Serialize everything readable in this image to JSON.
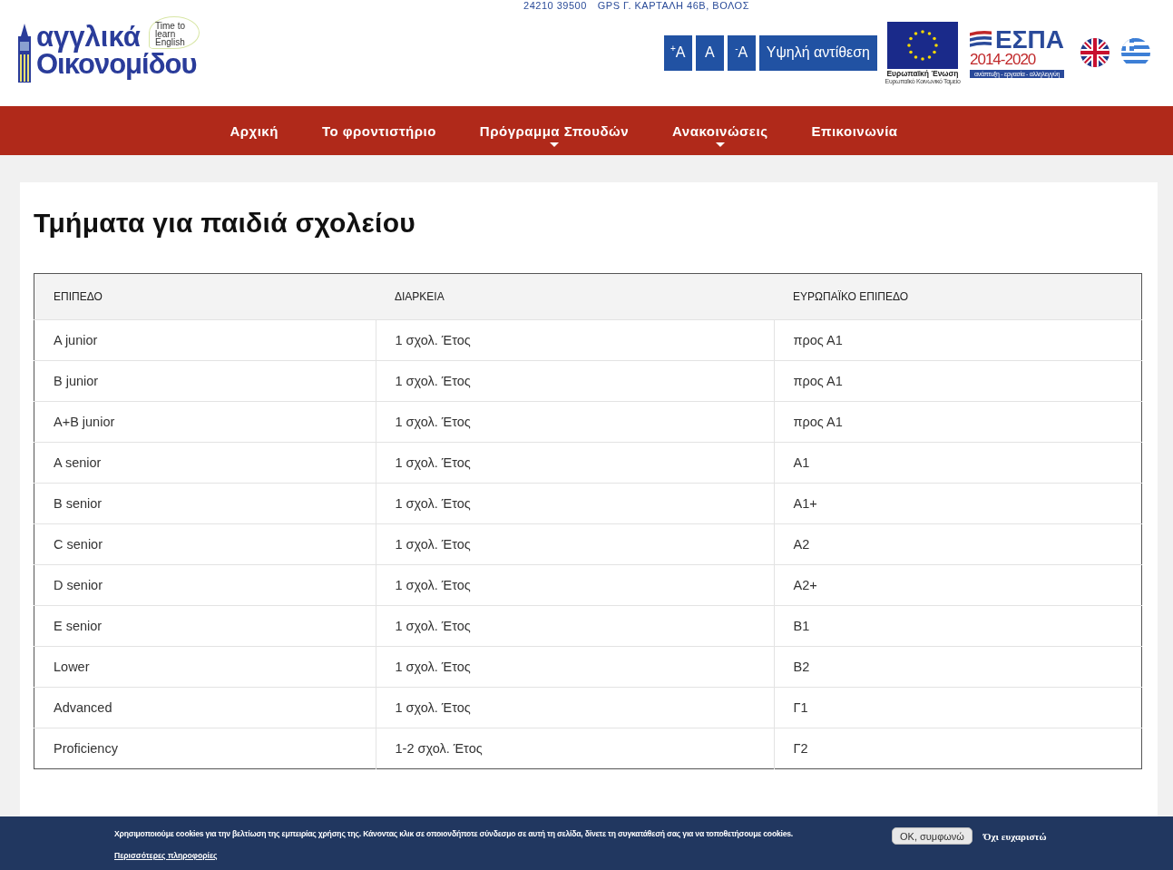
{
  "topbar": {
    "phone": "24210 39500",
    "address": "GPS Γ. ΚΑΡΤΑΛΗ 46Β, ΒΟΛΟΣ"
  },
  "logo": {
    "line_1": "αγγλικά",
    "line_2": "Οικονομίδου",
    "bubble": "Time to learn English"
  },
  "accessibility_buttons": [
    {
      "kind": "font_size",
      "sign": "+",
      "label": "A"
    },
    {
      "kind": "font_size",
      "label": "A"
    },
    {
      "kind": "font_size",
      "sign": "-",
      "label": "A"
    },
    {
      "kind": "contrast",
      "label": "Υψηλή αντίθεση"
    }
  ],
  "eu_logo": {
    "title": "Ευρωπαϊκή Ένωση",
    "subtitle": "Ευρωπαϊκό Κοινωνικό Ταμείο"
  },
  "espa_logo": {
    "title": "ΕΣΠΑ",
    "years": "2014-2020",
    "motto": "ανάπτυξη - εργασία - αλληλεγγύη"
  },
  "languages": [
    {
      "kind": "uk"
    },
    {
      "kind": "gr"
    }
  ],
  "nav": [
    {
      "label": "Αρχική",
      "has_submenu": false
    },
    {
      "label": "Το φροντιστήριο",
      "has_submenu": false
    },
    {
      "label": "Πρόγραμμα Σπουδών",
      "has_submenu": true
    },
    {
      "label": "Ανακοινώσεις",
      "has_submenu": true
    },
    {
      "label": "Επικοινωνία",
      "has_submenu": false
    }
  ],
  "page_title": "Τμήματα για παιδιά σχολείου",
  "table": {
    "columns": [
      "ΕΠΙΠΕΔΟ",
      "ΔΙΑΡΚΕΙΑ",
      "ΕΥΡΩΠΑΪΚΟ ΕΠΙΠΕΔΟ"
    ],
    "rows": [
      [
        "A junior",
        "1 σχολ. Έτος",
        "προς Α1"
      ],
      [
        "B junior",
        "1 σχολ. Έτος",
        "προς Α1"
      ],
      [
        "A+B junior",
        "1 σχολ. Έτος",
        "προς Α1"
      ],
      [
        "A senior",
        "1 σχολ. Έτος",
        "A1"
      ],
      [
        "B senior",
        "1 σχολ. Έτος",
        "A1+"
      ],
      [
        "C senior",
        "1 σχολ. Έτος",
        "A2"
      ],
      [
        "D senior",
        "1 σχολ. Έτος",
        "A2+"
      ],
      [
        "E senior",
        "1 σχολ. Έτος",
        "B1"
      ],
      [
        "Lower",
        "1 σχολ. Έτος",
        "B2"
      ],
      [
        "Advanced",
        "1 σχολ. Έτος",
        "Γ1"
      ],
      [
        "Proficiency",
        "1-2 σχολ. Έτος",
        "Γ2"
      ]
    ]
  },
  "cookie_bar": {
    "message": "Χρησιμοποιούμε cookies για την βελτίωση της εμπειρίας χρήσης της. Κάνοντας κλικ σε οποιονδήποτε σύνδεσμο σε αυτή τη σελίδα, δίνετε τη συγκατάθεσή σας για να τοποθετήσουμε cookies.",
    "more_link": "Περισσότερες πληροφορίες",
    "accept": "OK, συμφωνώ",
    "decline": "Όχι ευχαριστώ"
  }
}
